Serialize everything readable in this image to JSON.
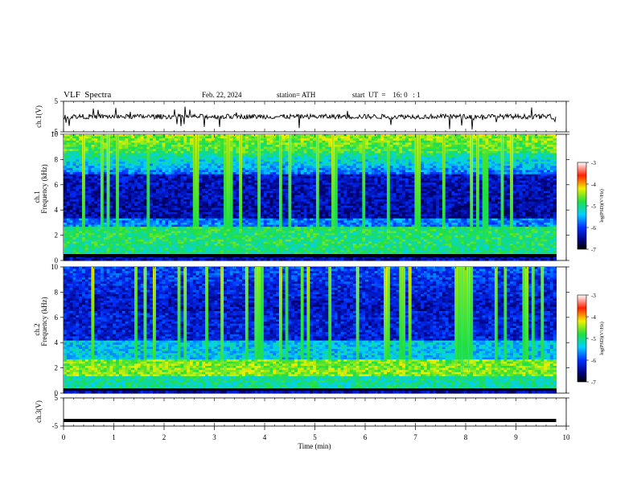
{
  "header": {
    "title": "VLF  Spectra",
    "date": "Feb. 22, 2024",
    "station": "station= ATH",
    "start": "start  UT  =    16: 0   : 1"
  },
  "chart_data": [
    {
      "id": "ch1-waveform",
      "type": "line",
      "ylabel": "ch.1(V)",
      "yticks": [
        "5",
        "-5"
      ],
      "ylim": [
        -5,
        5
      ],
      "xlim": [
        0,
        10
      ],
      "x_end": 9.8,
      "baseline": 0
    },
    {
      "id": "ch1-spectrogram",
      "type": "heatmap",
      "ylabel_line1": "ch.1",
      "ylabel_line2": "Frequency  (kHz)",
      "yticks": [
        "0",
        "2",
        "4",
        "6",
        "8",
        "10"
      ],
      "ylim": [
        0,
        10
      ],
      "xlim": [
        0,
        10
      ],
      "x_end": 9.8,
      "colorbar": {
        "label": "log(PSD)(V²/Hz)",
        "ticks": [
          "-3",
          "-4",
          "-5",
          "-6",
          "-7"
        ],
        "range": [
          -7,
          -3
        ]
      }
    },
    {
      "id": "ch2-spectrogram",
      "type": "heatmap",
      "ylabel_line1": "ch.2",
      "ylabel_line2": "Frequency  (kHz)",
      "yticks": [
        "0",
        "2",
        "4",
        "6",
        "8",
        "10"
      ],
      "ylim": [
        0,
        10
      ],
      "xlim": [
        0,
        10
      ],
      "x_end": 9.8,
      "colorbar": {
        "label": "log(PSD)(V²/Hz)",
        "ticks": [
          "-3",
          "-4",
          "-5",
          "-6",
          "-7"
        ],
        "range": [
          -7,
          -3
        ]
      }
    },
    {
      "id": "ch3-waveform",
      "type": "line",
      "ylabel": "ch.3(V)",
      "yticks": [
        "5",
        "-5"
      ],
      "ylim": [
        -5,
        5
      ],
      "xlim": [
        0,
        10
      ],
      "x_end": 9.8,
      "baseline": -3
    }
  ],
  "xaxis": {
    "label": "Time  (min)",
    "ticks": [
      "0",
      "1",
      "2",
      "3",
      "4",
      "5",
      "6",
      "7",
      "8",
      "9",
      "10"
    ],
    "range": [
      0,
      10
    ]
  },
  "colors": {
    "black": "#000000",
    "spec_low": "#0a1a8c",
    "spec_high": "#e83020"
  }
}
